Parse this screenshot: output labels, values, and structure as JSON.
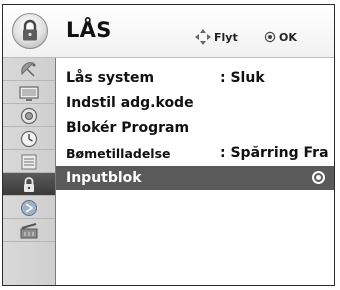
{
  "header": {
    "title": "LÅS",
    "hint_move": "Flyt",
    "hint_ok": "OK",
    "lock_icon": "lock-icon"
  },
  "sidebar": {
    "items": [
      {
        "icon": "satellite-dish-icon",
        "active": false
      },
      {
        "icon": "picture-icon",
        "active": false
      },
      {
        "icon": "audio-icon",
        "active": false
      },
      {
        "icon": "clock-icon",
        "active": false
      },
      {
        "icon": "option-icon",
        "active": false
      },
      {
        "icon": "lock-icon",
        "active": true
      },
      {
        "icon": "input-icon",
        "active": false
      },
      {
        "icon": "media-icon",
        "active": false
      }
    ]
  },
  "menu": {
    "items": [
      {
        "label": "Lås system",
        "value": ": Sluk"
      },
      {
        "label": "Indstil adg.kode",
        "value": ""
      },
      {
        "label": "Blokér Program",
        "value": ""
      },
      {
        "label": "Bømetilladelse",
        "value": ": Spărring Fra"
      },
      {
        "label": "Inputblok",
        "value": "",
        "selected": true
      }
    ]
  },
  "colors": {
    "selected_bg": "#5a5a5a",
    "sidebar_bg": "#d4d4d4",
    "text": "#111111"
  }
}
